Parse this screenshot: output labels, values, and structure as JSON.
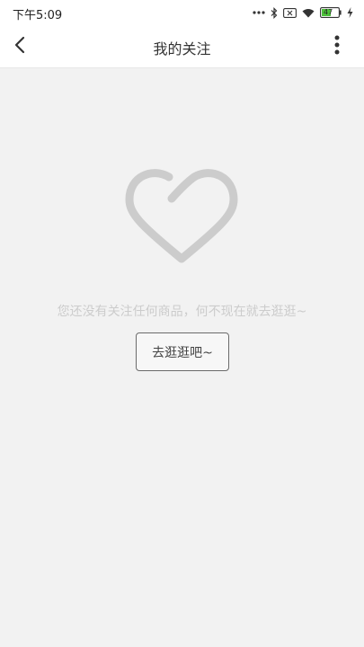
{
  "status_bar": {
    "time": "下午5:09",
    "battery_level": "47",
    "icons": [
      "more-dots-icon",
      "bluetooth-icon",
      "sim-off-icon",
      "wifi-icon",
      "battery-icon",
      "charging-icon"
    ]
  },
  "header": {
    "title": "我的关注",
    "back_icon": "chevron-left-icon",
    "menu_icon": "more-vertical-icon"
  },
  "empty_state": {
    "icon": "heart-icon",
    "message": "您还没有关注任何商品，何不现在就去逛逛~",
    "button_label": "去逛逛吧~"
  },
  "colors": {
    "background": "#f2f2f2",
    "header_background": "#ffffff",
    "icon_gray": "#cccccc",
    "message_text": "#cccccc",
    "battery_green": "#4cc13a"
  }
}
